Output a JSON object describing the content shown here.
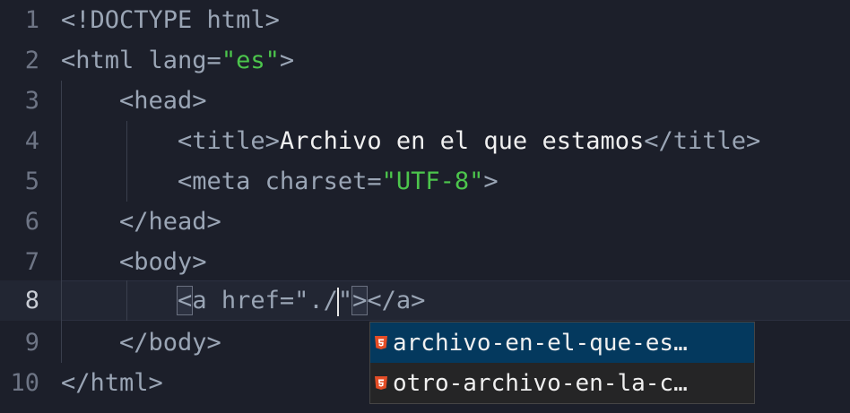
{
  "editor": {
    "lines": [
      {
        "num": "1",
        "tokens": [
          {
            "cls": "g-tag",
            "text": "<!DOCTYPE html>"
          }
        ]
      },
      {
        "num": "2",
        "tokens": [
          {
            "cls": "g-tag",
            "text": "<html lang="
          },
          {
            "cls": "g-str",
            "text": "\"es\""
          },
          {
            "cls": "g-tag",
            "text": ">"
          }
        ]
      },
      {
        "num": "3",
        "tokens": [
          {
            "cls": "g-tag",
            "text": "    <head>"
          }
        ]
      },
      {
        "num": "4",
        "tokens": [
          {
            "cls": "g-tag",
            "text": "        <title>"
          },
          {
            "cls": "g-text",
            "text": "Archivo en el que estamos"
          },
          {
            "cls": "g-tag",
            "text": "</title>"
          }
        ]
      },
      {
        "num": "5",
        "tokens": [
          {
            "cls": "g-tag",
            "text": "        <meta charset="
          },
          {
            "cls": "g-str",
            "text": "\"UTF-8\""
          },
          {
            "cls": "g-tag",
            "text": ">"
          }
        ]
      },
      {
        "num": "6",
        "tokens": [
          {
            "cls": "g-tag",
            "text": "    </head>"
          }
        ]
      },
      {
        "num": "7",
        "tokens": [
          {
            "cls": "g-tag",
            "text": "    <body>"
          }
        ]
      },
      {
        "num": "8",
        "tokens": [
          {
            "cls": "g-tag",
            "text": "        "
          },
          {
            "cls": "g-tag match",
            "text": "<"
          },
          {
            "cls": "g-tag",
            "text": "a href=\"./"
          },
          {
            "cls": "caret",
            "text": ""
          },
          {
            "cls": "g-tag",
            "text": "\""
          },
          {
            "cls": "g-tag match",
            "text": ">"
          },
          {
            "cls": "g-tag",
            "text": "</a>"
          }
        ]
      },
      {
        "num": "9",
        "tokens": [
          {
            "cls": "g-tag",
            "text": "    </body>"
          }
        ]
      },
      {
        "num": "10",
        "tokens": [
          {
            "cls": "g-tag",
            "text": "</html>"
          }
        ]
      }
    ],
    "current_line": "8"
  },
  "suggestions": {
    "items": [
      {
        "label": "archivo-en-el-que-es…",
        "icon": "html5-file-icon",
        "selected": true
      },
      {
        "label": "otro-archivo-en-la-c…",
        "icon": "html5-file-icon",
        "selected": false
      }
    ],
    "icon_color": "#e44d26"
  }
}
